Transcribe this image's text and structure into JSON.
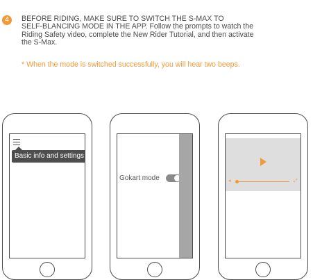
{
  "step": {
    "number": "4"
  },
  "instruction_lines": [
    "BEFORE RIDING, MAKE SURE TO SWITCH THE S-MAX TO",
    "SELF-BLANCING MODE IN THE APP. Follow the prompts to watch the",
    "Riding Safety video, complete the New Rider Tutorial, and then activate",
    "the S-Max."
  ],
  "note": "* When the mode is switched successfully, you will hear two beeps.",
  "phone1": {
    "tooltip": "Basic info and settings",
    "icon": "hamburger-menu-icon"
  },
  "phone2": {
    "toggle_label": "Gokart mode",
    "toggle_on": true
  },
  "phone3": {
    "icon": "play-icon"
  },
  "colors": {
    "accent": "#f29a38",
    "text": "#4a4a4a",
    "panel": "#a6a6a6",
    "video_bg": "#dedede"
  }
}
